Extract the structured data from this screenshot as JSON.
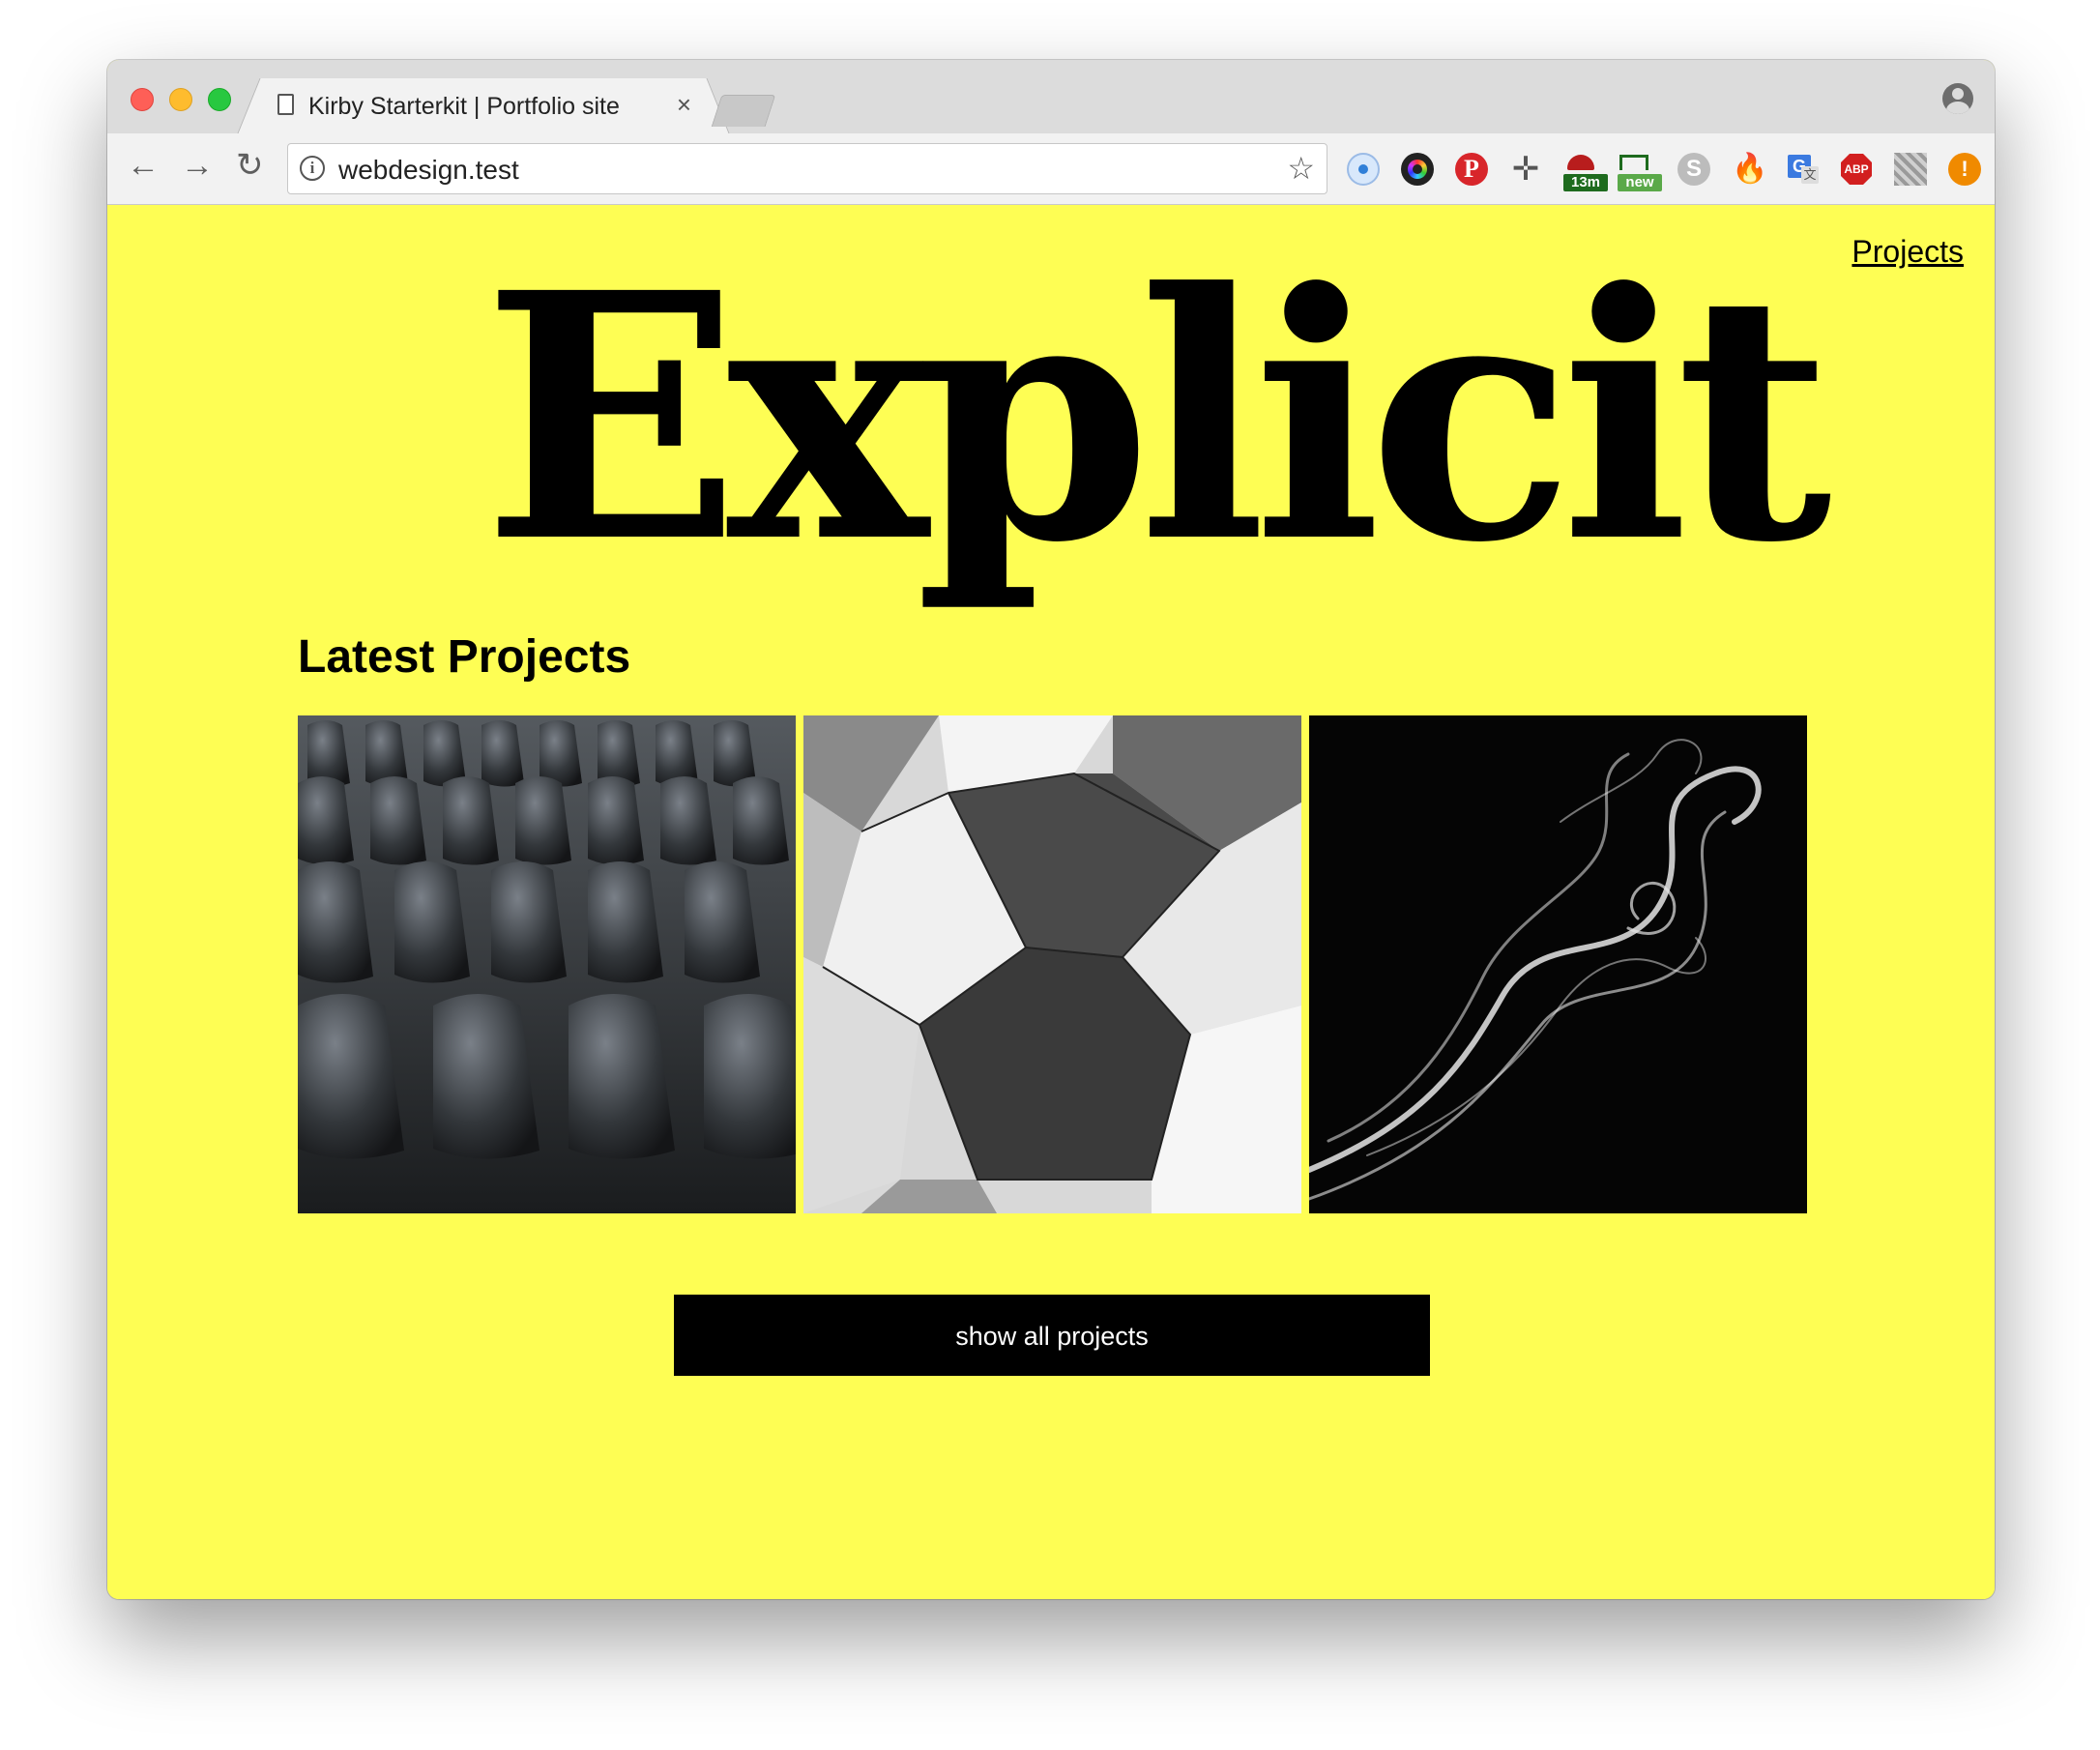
{
  "browser": {
    "tab": {
      "title": "Kirby Starterkit | Portfolio site",
      "close_glyph": "×"
    },
    "address": {
      "url": "webdesign.test"
    },
    "extensions": [
      {
        "name": "safari-extension-icon",
        "color": "#2f7fd8"
      },
      {
        "name": "color-picker-icon",
        "color": "#222222"
      },
      {
        "name": "pinterest-icon",
        "color": "#d8262b"
      },
      {
        "name": "ruler-icon",
        "color": "#555555"
      },
      {
        "name": "timer-icon",
        "color": "#b81d1d",
        "badge": "13m",
        "badge_color": "#1e6b1e"
      },
      {
        "name": "screenshot-icon",
        "color": "#1e6b1e",
        "badge": "new",
        "badge_color": "#5aa949"
      },
      {
        "name": "skype-icon",
        "color": "#bcbcbc"
      },
      {
        "name": "fire-icon",
        "color": "#f08a00"
      },
      {
        "name": "google-translate-icon",
        "color": "#3b7ae0"
      },
      {
        "name": "adblock-icon",
        "color": "#d21f1f",
        "label": "ABP"
      },
      {
        "name": "qr-code-icon",
        "color": "#9a9a9a"
      },
      {
        "name": "notification-icon",
        "color": "#f08a00",
        "label": "!"
      }
    ]
  },
  "page": {
    "background": "#fefe54",
    "nav": {
      "projects_label": "Projects"
    },
    "logo": "Explicit",
    "section_title": "Latest Projects",
    "projects": [
      {
        "name": "chairs-thumbnail"
      },
      {
        "name": "architecture-thumbnail"
      },
      {
        "name": "smoke-thumbnail"
      }
    ],
    "show_all_label": "show all projects"
  }
}
